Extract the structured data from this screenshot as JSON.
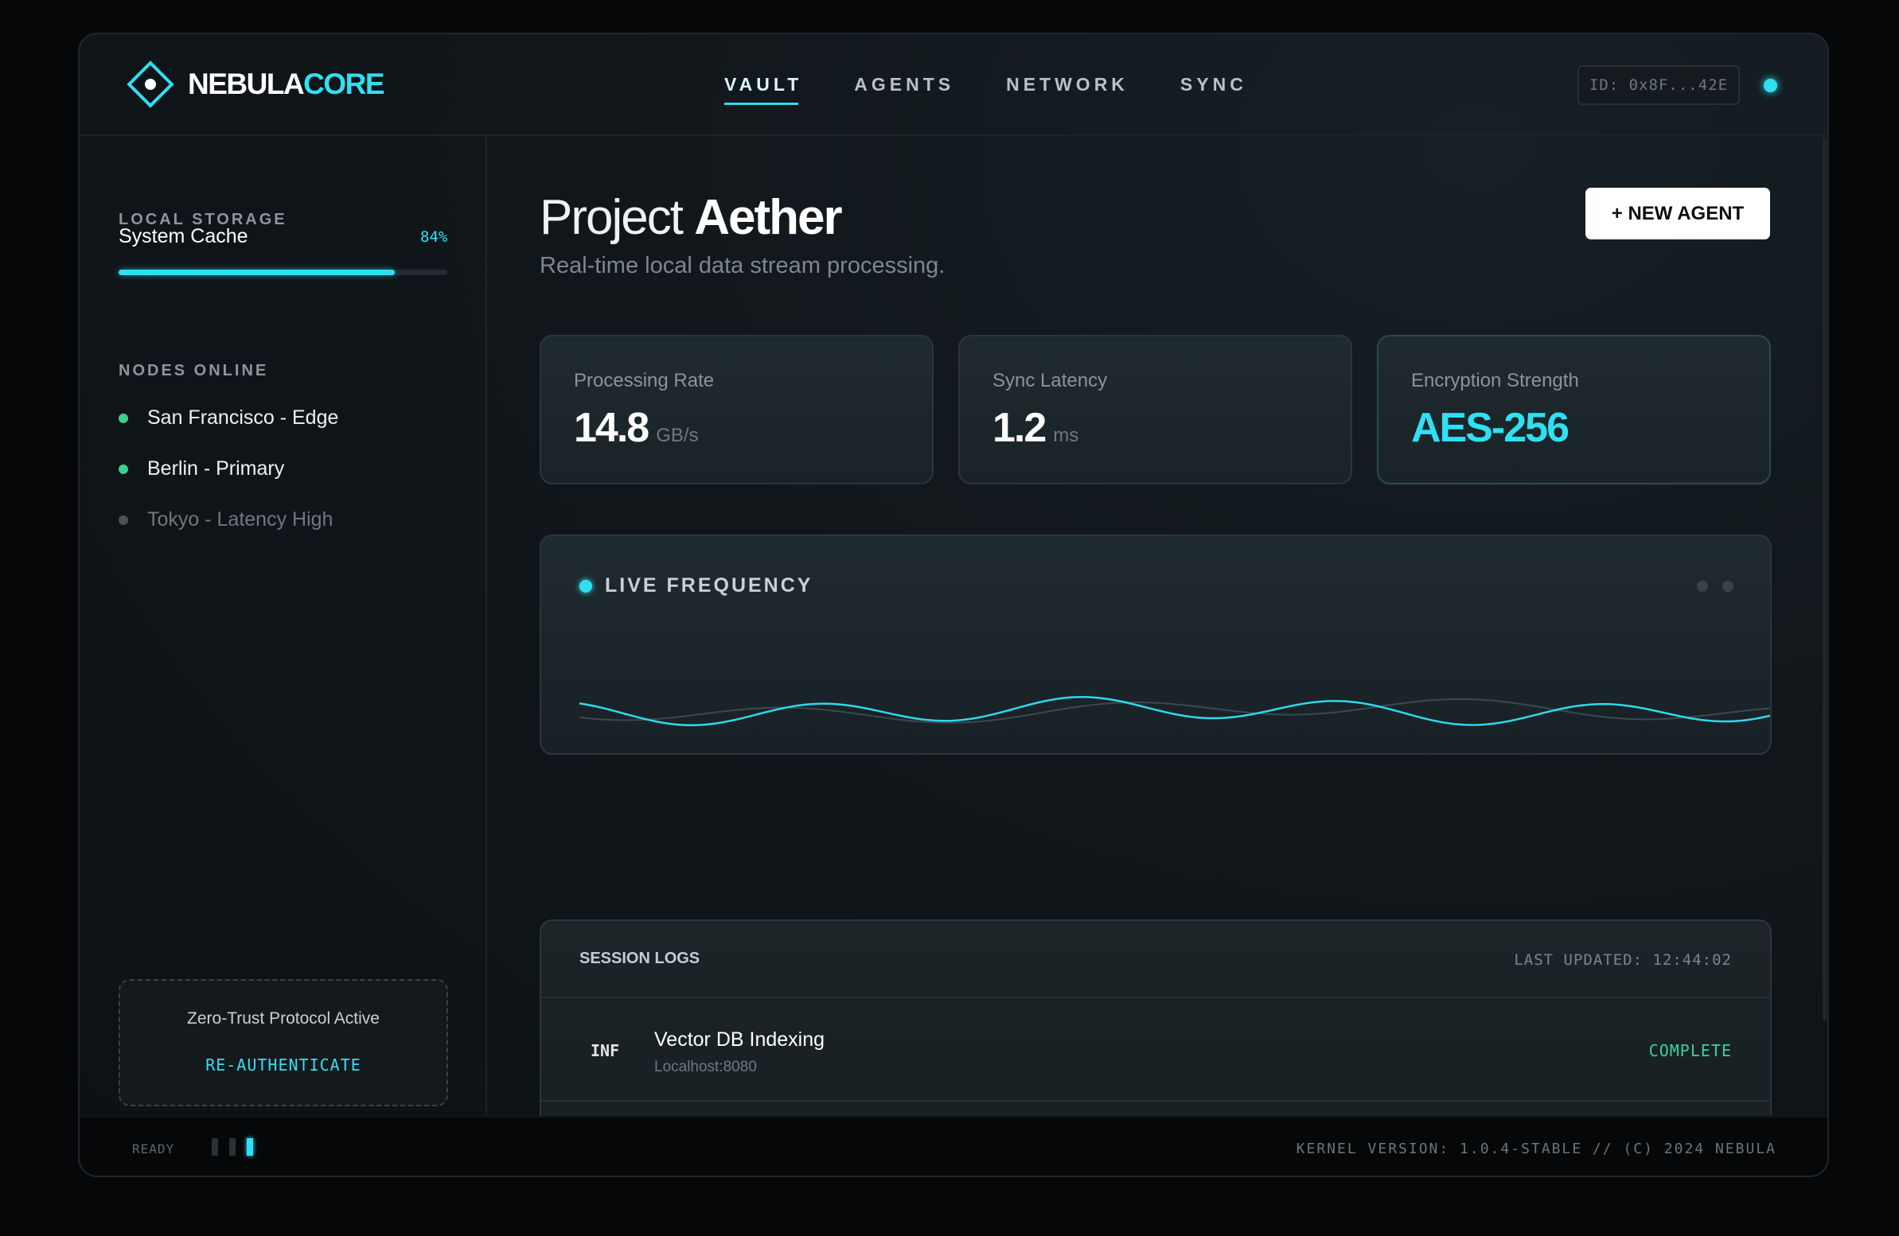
{
  "header": {
    "logo_part1": "NEBULA",
    "logo_part2": "CORE",
    "nav": [
      {
        "label": "VAULT",
        "active": true
      },
      {
        "label": "AGENTS",
        "active": false
      },
      {
        "label": "NETWORK",
        "active": false
      },
      {
        "label": "SYNC",
        "active": false
      }
    ],
    "session_id": "ID: 0x8F...42E"
  },
  "sidebar": {
    "storage_label": "LOCAL STORAGE",
    "cache_label": "System Cache",
    "cache_percent": "84%",
    "cache_fill": 0.84,
    "nodes_label": "NODES ONLINE",
    "nodes": [
      {
        "name": "San Francisco - Edge",
        "status": "online"
      },
      {
        "name": "Berlin - Primary",
        "status": "online"
      },
      {
        "name": "Tokyo - Latency High",
        "status": "degraded"
      }
    ],
    "trust_text": "Zero-Trust Protocol Active",
    "reauth_label": "RE-AUTHENTICATE"
  },
  "main": {
    "title_light": "Project",
    "title_bold": "Aether",
    "subtitle": "Real-time local data stream processing.",
    "new_agent_label": "+ NEW AGENT",
    "stats": [
      {
        "label": "Processing Rate",
        "value": "14.8",
        "unit": "GB/s"
      },
      {
        "label": "Sync Latency",
        "value": "1.2",
        "unit": "ms"
      },
      {
        "label": "Encryption Strength",
        "value": "AES-256",
        "unit": ""
      }
    ],
    "frequency_title": "LIVE FREQUENCY",
    "logs": {
      "title": "SESSION LOGS",
      "updated": "LAST UPDATED: 12:44:02",
      "rows": [
        {
          "level": "INF",
          "name": "Vector DB Indexing",
          "host": "Localhost:8080",
          "status": "COMPLETE"
        }
      ]
    }
  },
  "footer": {
    "ready": "READY",
    "kernel": "KERNEL VERSION: 1.0.4-STABLE // (C) 2024 NEBULA"
  },
  "colors": {
    "accent": "#2fe0f2",
    "online": "#3ccf8e",
    "degraded": "#4a5257",
    "complete": "#37d39a"
  }
}
